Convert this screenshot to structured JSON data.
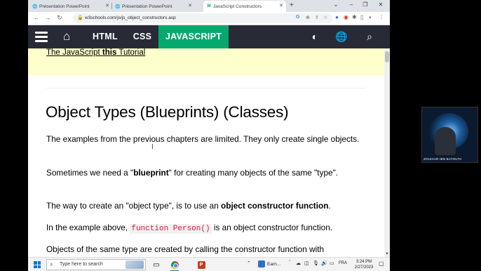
{
  "browser": {
    "tabs": [
      {
        "title": "Présentation PowerPoint",
        "active": false
      },
      {
        "title": "Présentation PowerPoint",
        "active": false
      },
      {
        "title": "JavaScript Constructors",
        "active": true
      }
    ],
    "new_tab_label": "+",
    "window_controls": {
      "minimize": "–",
      "maximize": "❐",
      "close": "✕",
      "collapse": "⌄"
    },
    "url": "w3schools.com/js/js_object_constructors.asp"
  },
  "w3nav": {
    "links": {
      "html": "HTML",
      "css": "CSS",
      "javascript": "JAVASCRIPT"
    },
    "active_color": "#04aa6d",
    "bar_color": "#282a35"
  },
  "content": {
    "tutorial_link": {
      "before": "The JavaScript ",
      "bold": "this",
      "after": " Tutorial"
    },
    "heading": "Object Types (Blueprints) (Classes)",
    "p1": "The examples from the previous chapters are limited. They only create single objects.",
    "p2": {
      "before": "Sometimes we need a \"",
      "bold": "blueprint",
      "after": "\" for creating many objects of the same \"type\"."
    },
    "p3": {
      "before": "The way to create an \"object type\", is to use an ",
      "bold": "object constructor function",
      "after": "."
    },
    "p4": {
      "before": "In the example above, ",
      "code": "function Person()",
      "after": " is an object constructor function."
    },
    "p5": "Objects of the same type are created by calling the constructor function with"
  },
  "webcam": {
    "name": "ZOUHAIR IBN BATOUTA"
  },
  "taskbar": {
    "search_placeholder": "Type here to search",
    "weather": "Earn...",
    "language": "FRA",
    "time": "3:24 PM",
    "date": "2/27/2023"
  }
}
